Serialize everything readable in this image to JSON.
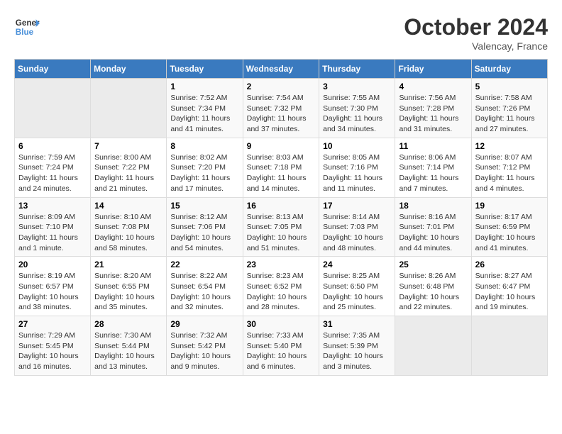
{
  "header": {
    "logo_line1": "General",
    "logo_line2": "Blue",
    "month": "October 2024",
    "location": "Valencay, France"
  },
  "days_of_week": [
    "Sunday",
    "Monday",
    "Tuesday",
    "Wednesday",
    "Thursday",
    "Friday",
    "Saturday"
  ],
  "weeks": [
    [
      {
        "num": "",
        "sunrise": "",
        "sunset": "",
        "daylight": "",
        "empty": true
      },
      {
        "num": "",
        "sunrise": "",
        "sunset": "",
        "daylight": "",
        "empty": true
      },
      {
        "num": "1",
        "sunrise": "Sunrise: 7:52 AM",
        "sunset": "Sunset: 7:34 PM",
        "daylight": "Daylight: 11 hours and 41 minutes.",
        "empty": false
      },
      {
        "num": "2",
        "sunrise": "Sunrise: 7:54 AM",
        "sunset": "Sunset: 7:32 PM",
        "daylight": "Daylight: 11 hours and 37 minutes.",
        "empty": false
      },
      {
        "num": "3",
        "sunrise": "Sunrise: 7:55 AM",
        "sunset": "Sunset: 7:30 PM",
        "daylight": "Daylight: 11 hours and 34 minutes.",
        "empty": false
      },
      {
        "num": "4",
        "sunrise": "Sunrise: 7:56 AM",
        "sunset": "Sunset: 7:28 PM",
        "daylight": "Daylight: 11 hours and 31 minutes.",
        "empty": false
      },
      {
        "num": "5",
        "sunrise": "Sunrise: 7:58 AM",
        "sunset": "Sunset: 7:26 PM",
        "daylight": "Daylight: 11 hours and 27 minutes.",
        "empty": false
      }
    ],
    [
      {
        "num": "6",
        "sunrise": "Sunrise: 7:59 AM",
        "sunset": "Sunset: 7:24 PM",
        "daylight": "Daylight: 11 hours and 24 minutes.",
        "empty": false
      },
      {
        "num": "7",
        "sunrise": "Sunrise: 8:00 AM",
        "sunset": "Sunset: 7:22 PM",
        "daylight": "Daylight: 11 hours and 21 minutes.",
        "empty": false
      },
      {
        "num": "8",
        "sunrise": "Sunrise: 8:02 AM",
        "sunset": "Sunset: 7:20 PM",
        "daylight": "Daylight: 11 hours and 17 minutes.",
        "empty": false
      },
      {
        "num": "9",
        "sunrise": "Sunrise: 8:03 AM",
        "sunset": "Sunset: 7:18 PM",
        "daylight": "Daylight: 11 hours and 14 minutes.",
        "empty": false
      },
      {
        "num": "10",
        "sunrise": "Sunrise: 8:05 AM",
        "sunset": "Sunset: 7:16 PM",
        "daylight": "Daylight: 11 hours and 11 minutes.",
        "empty": false
      },
      {
        "num": "11",
        "sunrise": "Sunrise: 8:06 AM",
        "sunset": "Sunset: 7:14 PM",
        "daylight": "Daylight: 11 hours and 7 minutes.",
        "empty": false
      },
      {
        "num": "12",
        "sunrise": "Sunrise: 8:07 AM",
        "sunset": "Sunset: 7:12 PM",
        "daylight": "Daylight: 11 hours and 4 minutes.",
        "empty": false
      }
    ],
    [
      {
        "num": "13",
        "sunrise": "Sunrise: 8:09 AM",
        "sunset": "Sunset: 7:10 PM",
        "daylight": "Daylight: 11 hours and 1 minute.",
        "empty": false
      },
      {
        "num": "14",
        "sunrise": "Sunrise: 8:10 AM",
        "sunset": "Sunset: 7:08 PM",
        "daylight": "Daylight: 10 hours and 58 minutes.",
        "empty": false
      },
      {
        "num": "15",
        "sunrise": "Sunrise: 8:12 AM",
        "sunset": "Sunset: 7:06 PM",
        "daylight": "Daylight: 10 hours and 54 minutes.",
        "empty": false
      },
      {
        "num": "16",
        "sunrise": "Sunrise: 8:13 AM",
        "sunset": "Sunset: 7:05 PM",
        "daylight": "Daylight: 10 hours and 51 minutes.",
        "empty": false
      },
      {
        "num": "17",
        "sunrise": "Sunrise: 8:14 AM",
        "sunset": "Sunset: 7:03 PM",
        "daylight": "Daylight: 10 hours and 48 minutes.",
        "empty": false
      },
      {
        "num": "18",
        "sunrise": "Sunrise: 8:16 AM",
        "sunset": "Sunset: 7:01 PM",
        "daylight": "Daylight: 10 hours and 44 minutes.",
        "empty": false
      },
      {
        "num": "19",
        "sunrise": "Sunrise: 8:17 AM",
        "sunset": "Sunset: 6:59 PM",
        "daylight": "Daylight: 10 hours and 41 minutes.",
        "empty": false
      }
    ],
    [
      {
        "num": "20",
        "sunrise": "Sunrise: 8:19 AM",
        "sunset": "Sunset: 6:57 PM",
        "daylight": "Daylight: 10 hours and 38 minutes.",
        "empty": false
      },
      {
        "num": "21",
        "sunrise": "Sunrise: 8:20 AM",
        "sunset": "Sunset: 6:55 PM",
        "daylight": "Daylight: 10 hours and 35 minutes.",
        "empty": false
      },
      {
        "num": "22",
        "sunrise": "Sunrise: 8:22 AM",
        "sunset": "Sunset: 6:54 PM",
        "daylight": "Daylight: 10 hours and 32 minutes.",
        "empty": false
      },
      {
        "num": "23",
        "sunrise": "Sunrise: 8:23 AM",
        "sunset": "Sunset: 6:52 PM",
        "daylight": "Daylight: 10 hours and 28 minutes.",
        "empty": false
      },
      {
        "num": "24",
        "sunrise": "Sunrise: 8:25 AM",
        "sunset": "Sunset: 6:50 PM",
        "daylight": "Daylight: 10 hours and 25 minutes.",
        "empty": false
      },
      {
        "num": "25",
        "sunrise": "Sunrise: 8:26 AM",
        "sunset": "Sunset: 6:48 PM",
        "daylight": "Daylight: 10 hours and 22 minutes.",
        "empty": false
      },
      {
        "num": "26",
        "sunrise": "Sunrise: 8:27 AM",
        "sunset": "Sunset: 6:47 PM",
        "daylight": "Daylight: 10 hours and 19 minutes.",
        "empty": false
      }
    ],
    [
      {
        "num": "27",
        "sunrise": "Sunrise: 7:29 AM",
        "sunset": "Sunset: 5:45 PM",
        "daylight": "Daylight: 10 hours and 16 minutes.",
        "empty": false
      },
      {
        "num": "28",
        "sunrise": "Sunrise: 7:30 AM",
        "sunset": "Sunset: 5:44 PM",
        "daylight": "Daylight: 10 hours and 13 minutes.",
        "empty": false
      },
      {
        "num": "29",
        "sunrise": "Sunrise: 7:32 AM",
        "sunset": "Sunset: 5:42 PM",
        "daylight": "Daylight: 10 hours and 9 minutes.",
        "empty": false
      },
      {
        "num": "30",
        "sunrise": "Sunrise: 7:33 AM",
        "sunset": "Sunset: 5:40 PM",
        "daylight": "Daylight: 10 hours and 6 minutes.",
        "empty": false
      },
      {
        "num": "31",
        "sunrise": "Sunrise: 7:35 AM",
        "sunset": "Sunset: 5:39 PM",
        "daylight": "Daylight: 10 hours and 3 minutes.",
        "empty": false
      },
      {
        "num": "",
        "sunrise": "",
        "sunset": "",
        "daylight": "",
        "empty": true
      },
      {
        "num": "",
        "sunrise": "",
        "sunset": "",
        "daylight": "",
        "empty": true
      }
    ]
  ]
}
